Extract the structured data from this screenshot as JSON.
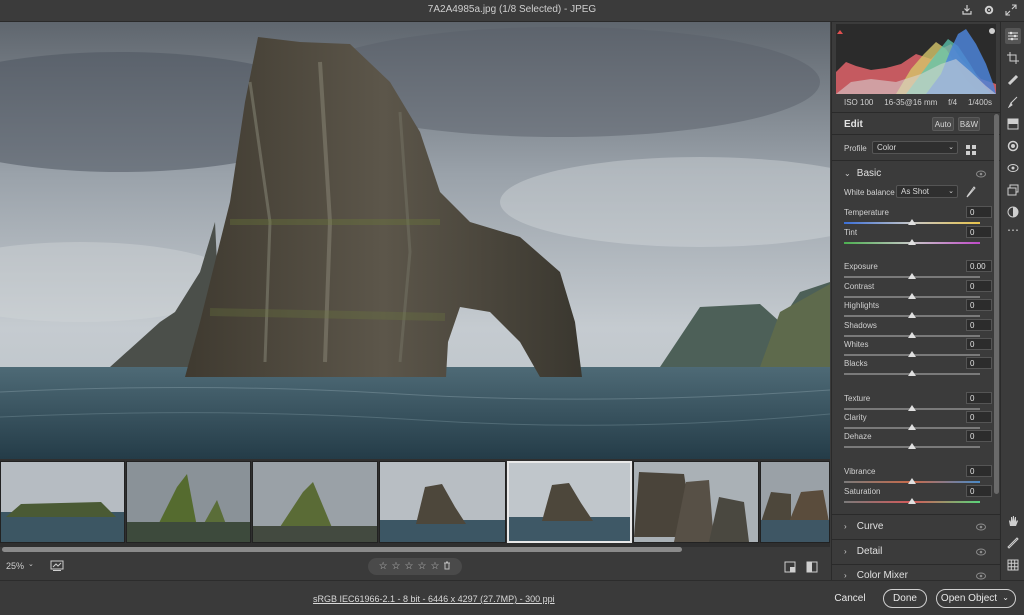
{
  "titlebar": {
    "title": "7A2A4985a.jpg  (1/8 Selected)  -  JPEG"
  },
  "exif": {
    "iso": "ISO 100",
    "lens": "16-35@16 mm",
    "aperture": "f/4",
    "shutter": "1/400s"
  },
  "edit": {
    "heading": "Edit",
    "auto_label": "Auto",
    "bw_label": "B&W",
    "profile_label": "Profile",
    "profile_value": "Color",
    "basic_label": "Basic",
    "white_balance_label": "White balance",
    "white_balance_value": "As Shot"
  },
  "sliders": [
    {
      "label": "Temperature",
      "value": "0",
      "pos": 0.5
    },
    {
      "label": "Tint",
      "value": "0",
      "pos": 0.5
    },
    {
      "label": "Exposure",
      "value": "0.00",
      "pos": 0.5
    },
    {
      "label": "Contrast",
      "value": "0",
      "pos": 0.5
    },
    {
      "label": "Highlights",
      "value": "0",
      "pos": 0.5
    },
    {
      "label": "Shadows",
      "value": "0",
      "pos": 0.5
    },
    {
      "label": "Whites",
      "value": "0",
      "pos": 0.5
    },
    {
      "label": "Blacks",
      "value": "0",
      "pos": 0.5
    },
    {
      "label": "Texture",
      "value": "0",
      "pos": 0.5
    },
    {
      "label": "Clarity",
      "value": "0",
      "pos": 0.5
    },
    {
      "label": "Dehaze",
      "value": "0",
      "pos": 0.5
    },
    {
      "label": "Vibrance",
      "value": "0",
      "pos": 0.5
    },
    {
      "label": "Saturation",
      "value": "0",
      "pos": 0.5
    }
  ],
  "sections": {
    "curve": "Curve",
    "detail": "Detail",
    "color_mixer": "Color Mixer"
  },
  "canvas_toolbar": {
    "zoom": "25%"
  },
  "status": {
    "image_info": "sRGB IEC61966-2.1 - 8 bit - 6446 x 4297 (27.7MP) - 300 ppi"
  },
  "footer": {
    "cancel": "Cancel",
    "done": "Done",
    "open_object": "Open Object"
  },
  "colors": {
    "panel_bg": "#3b3b3b",
    "canvas_bg": "#2f2f2f",
    "accent": "#e8e8e8"
  }
}
